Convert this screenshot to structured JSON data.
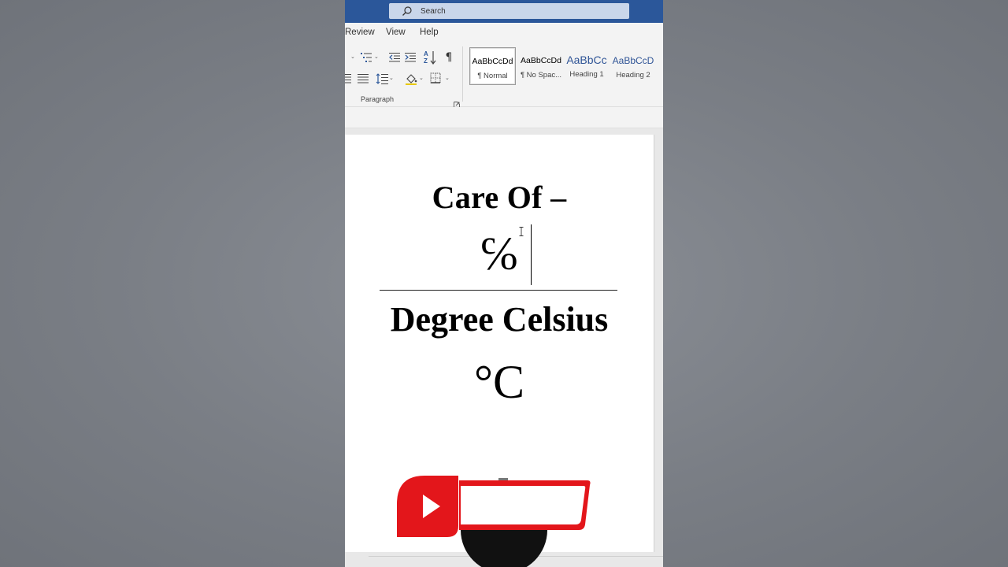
{
  "titlebar": {
    "search_placeholder": "Search"
  },
  "menu": [
    "Review",
    "View",
    "Help"
  ],
  "ribbon": {
    "paragraph_group_label": "Paragraph",
    "styles": [
      {
        "sample": "AaBbCcDd",
        "name": "¶ Normal"
      },
      {
        "sample": "AaBbCcDd",
        "name": "¶ No Spac..."
      },
      {
        "sample": "AaBbCc",
        "name": "Heading 1"
      },
      {
        "sample": "AaBbCcD",
        "name": "Heading 2"
      }
    ],
    "sort_icon_label": "AZ",
    "pilcrow": "¶"
  },
  "document": {
    "line1": "Care Of –",
    "line2": "℅",
    "line3": "Degree Celsius",
    "line4": "°C"
  },
  "colors": {
    "titlebar": "#2b579a",
    "search_box": "#c9d6ea",
    "heading_blue": "#2f5496",
    "logo_red": "#e3161b"
  }
}
